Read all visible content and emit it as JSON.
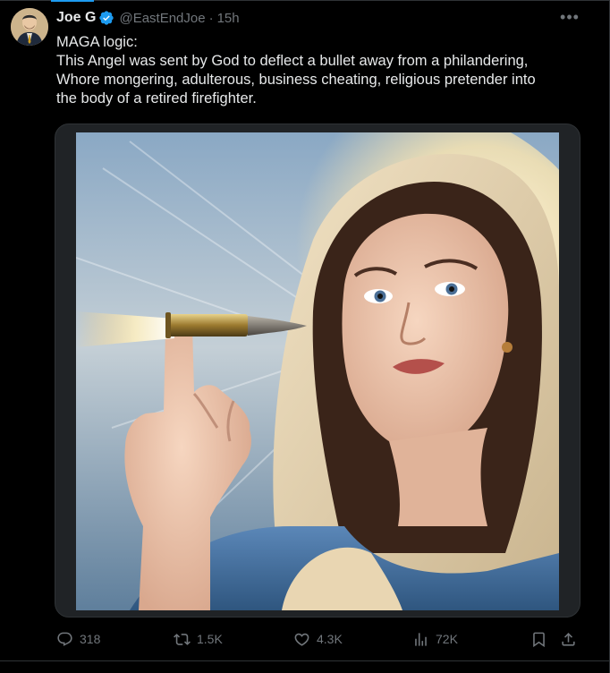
{
  "tweet": {
    "author_name": "Joe G",
    "handle": "@EastEndJoe",
    "separator": "·",
    "time": "15h",
    "more_label": "•••",
    "text_lines": [
      "MAGA logic:",
      "This Angel was sent by God to deflect a bullet away from a philandering,",
      "Whore mongering, adulterous, business cheating, religious pretender into",
      "the body of a retired firefighter."
    ],
    "media_icon": "ai-image-woman-deflecting-bullet",
    "stats": {
      "replies": "318",
      "reposts": "1.5K",
      "likes": "4.3K",
      "views": "72K"
    }
  },
  "colors": {
    "background": "#000000",
    "text": "#e7e9ea",
    "muted": "#71767b",
    "accent": "#1d9bf0",
    "border": "#2f3336"
  }
}
